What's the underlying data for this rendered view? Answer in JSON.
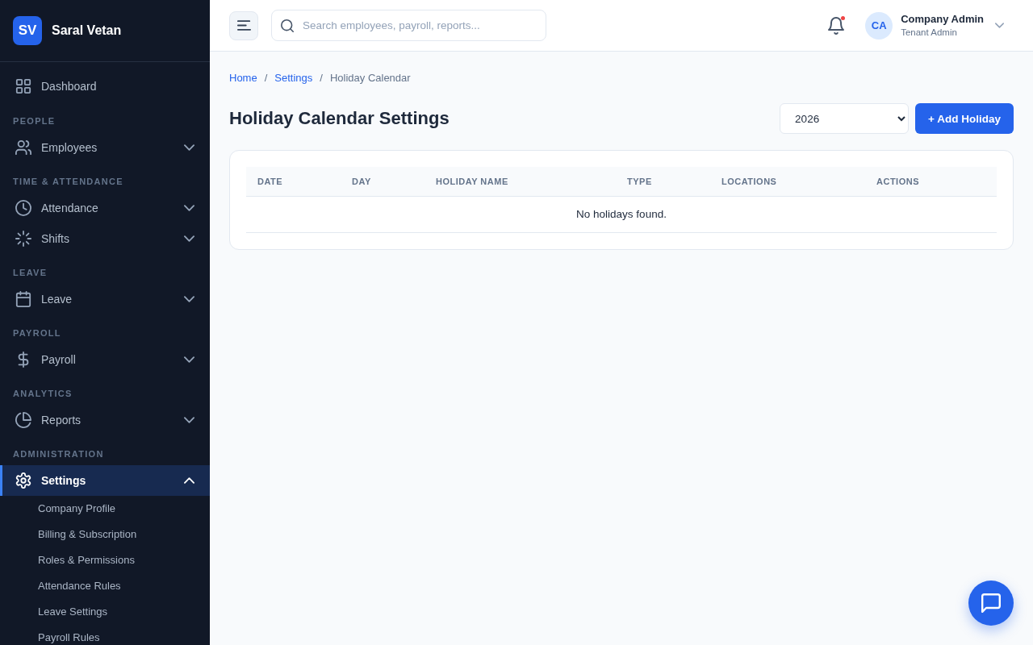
{
  "sidebar": {
    "logo": {
      "initials": "SV",
      "name": "Saral Vetan"
    },
    "sections": [
      {
        "items": [
          {
            "kind": "link",
            "label": "Dashboard",
            "selected": false
          }
        ]
      },
      {
        "heading": "PEOPLE",
        "items": [
          {
            "kind": "group",
            "label": "Employees",
            "selected": false,
            "expanded": false
          }
        ]
      },
      {
        "heading": "TIME & ATTENDANCE",
        "items": [
          {
            "kind": "group",
            "label": "Attendance",
            "selected": false,
            "expanded": false
          },
          {
            "kind": "group",
            "label": "Shifts",
            "selected": false,
            "expanded": false
          }
        ]
      },
      {
        "heading": "LEAVE",
        "items": [
          {
            "kind": "group",
            "label": "Leave",
            "selected": false,
            "expanded": false
          }
        ]
      },
      {
        "heading": "PAYROLL",
        "items": [
          {
            "kind": "group",
            "label": "Payroll",
            "selected": false,
            "expanded": false
          }
        ]
      },
      {
        "heading": "ANALYTICS",
        "items": [
          {
            "kind": "group",
            "label": "Reports",
            "selected": false,
            "expanded": false
          }
        ]
      },
      {
        "heading": "ADMINISTRATION",
        "items": [
          {
            "kind": "group",
            "label": "Settings",
            "selected": true,
            "expanded": true,
            "children": [
              {
                "label": "Company Profile",
                "selected": false
              },
              {
                "label": "Billing & Subscription",
                "selected": false
              },
              {
                "label": "Roles & Permissions",
                "selected": false
              },
              {
                "label": "Attendance Rules",
                "selected": false
              },
              {
                "label": "Leave Settings",
                "selected": false
              },
              {
                "label": "Payroll Rules",
                "selected": false
              }
            ]
          }
        ]
      }
    ]
  },
  "header": {
    "search": {
      "placeholder": "Search employees, payroll, reports..."
    },
    "notifications": {
      "unread": true
    },
    "user": {
      "initials": "CA",
      "name": "Company Admin",
      "role": "Tenant Admin"
    }
  },
  "breadcrumb": [
    {
      "kind": "link",
      "label": "Home"
    },
    {
      "kind": "separator",
      "label": "/"
    },
    {
      "kind": "link",
      "label": "Settings"
    },
    {
      "kind": "separator",
      "label": "/"
    },
    {
      "kind": "current",
      "label": "Holiday Calendar"
    }
  ],
  "page": {
    "title": "Holiday Calendar Settings",
    "year_select": {
      "value": "2026"
    },
    "add_button": {
      "label": "+ Add Holiday"
    }
  },
  "table": {
    "columns": [
      "DATE",
      "DAY",
      "HOLIDAY NAME",
      "TYPE",
      "LOCATIONS",
      "ACTIONS"
    ],
    "empty_message": "No holidays found."
  }
}
